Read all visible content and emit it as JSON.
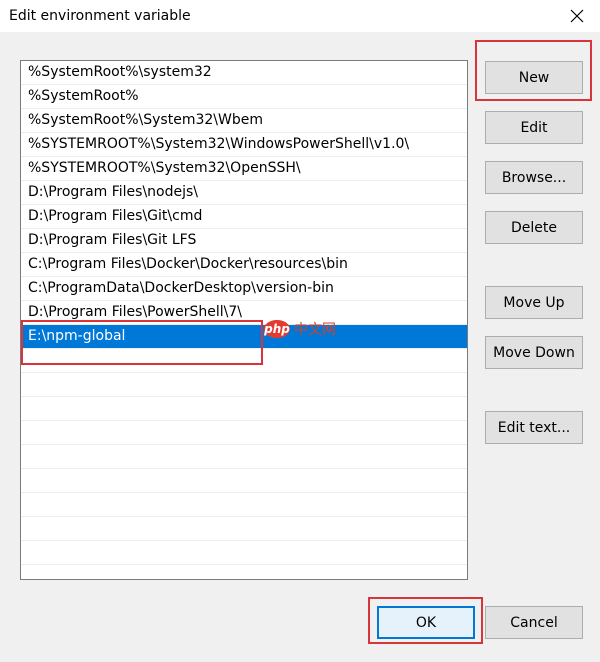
{
  "window": {
    "title": "Edit environment variable"
  },
  "list": {
    "items": [
      "%SystemRoot%\\system32",
      "%SystemRoot%",
      "%SystemRoot%\\System32\\Wbem",
      "%SYSTEMROOT%\\System32\\WindowsPowerShell\\v1.0\\",
      "%SYSTEMROOT%\\System32\\OpenSSH\\",
      "D:\\Program Files\\nodejs\\",
      "D:\\Program Files\\Git\\cmd",
      "D:\\Program Files\\Git LFS",
      "C:\\Program Files\\Docker\\Docker\\resources\\bin",
      "C:\\ProgramData\\DockerDesktop\\version-bin",
      "D:\\Program Files\\PowerShell\\7\\",
      "E:\\npm-global"
    ],
    "selected_index": 11
  },
  "buttons": {
    "new": "New",
    "edit": "Edit",
    "browse": "Browse...",
    "delete": "Delete",
    "move_up": "Move Up",
    "move_down": "Move Down",
    "edit_text": "Edit text...",
    "ok": "OK",
    "cancel": "Cancel"
  },
  "watermark": {
    "badge": "php",
    "text": "中文网"
  },
  "colors": {
    "selection": "#0078d7",
    "highlight_box": "#d9343b"
  }
}
